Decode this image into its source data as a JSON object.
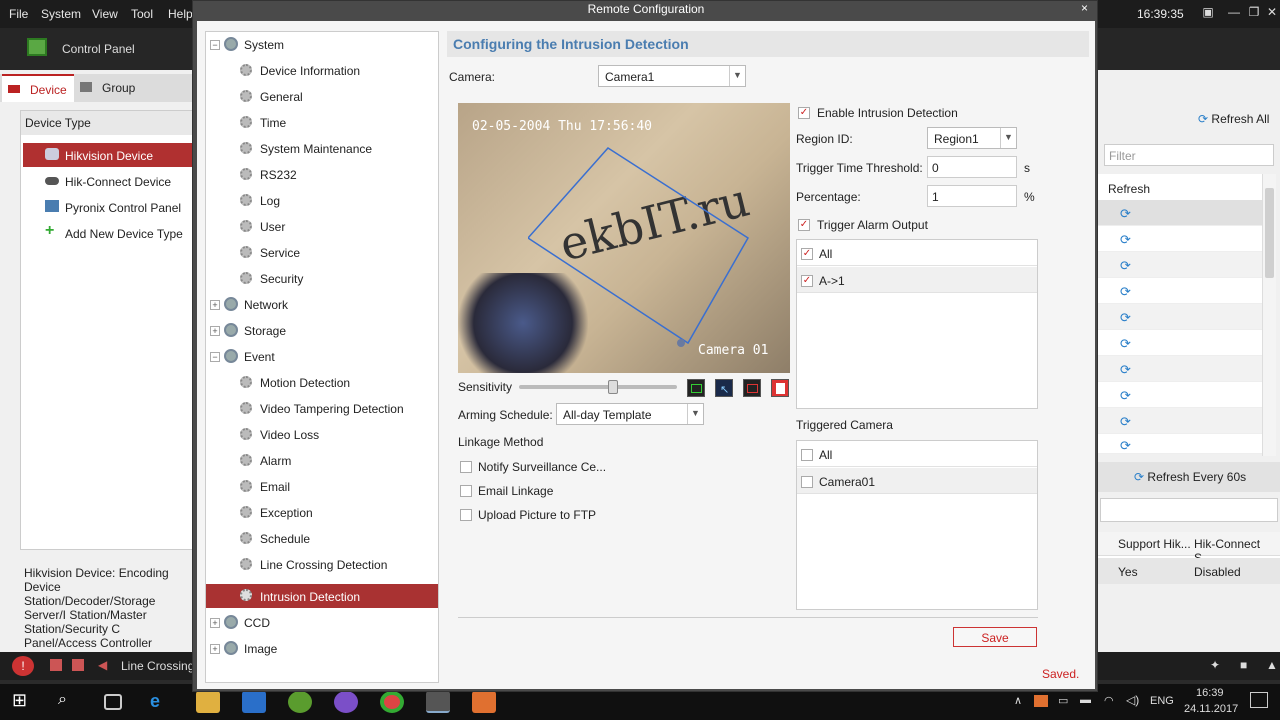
{
  "menubar": {
    "items": [
      "File",
      "System",
      "View",
      "Tool",
      "Help"
    ],
    "clock": "16:39:35"
  },
  "toolbar": {
    "control_panel": "Control Panel"
  },
  "left_panel": {
    "tabs": [
      "Device",
      "Group"
    ],
    "device_type_title": "Device Type",
    "device_types": [
      "Hikvision Device",
      "Hik-Connect Device",
      "Pyronix Control Panel",
      "Add New Device Type"
    ],
    "description": "Hikvision Device: Encoding Device Station/Decoder/Storage Server/I Station/Master Station/Security C Panel/Access Controller"
  },
  "right_panel": {
    "refresh_all": "Refresh All",
    "filter_placeholder": "Filter",
    "refresh_header": "Refresh",
    "refresh_every": "Refresh Every 60s",
    "table_headers": [
      "Support Hik...",
      "Hik-Connect S..."
    ],
    "table_values": [
      "Yes",
      "Disabled"
    ]
  },
  "bottom_strip": {
    "label": "Line Crossing"
  },
  "taskbar": {
    "lang": "ENG",
    "time": "16:39",
    "date": "24.11.2017"
  },
  "dialog": {
    "title": "Remote Configuration",
    "close": "×",
    "tree": {
      "system": "System",
      "system_children": [
        "Device Information",
        "General",
        "Time",
        "System Maintenance",
        "RS232",
        "Log",
        "User",
        "Service",
        "Security"
      ],
      "network": "Network",
      "storage": "Storage",
      "event": "Event",
      "event_children": [
        "Motion Detection",
        "Video Tampering Detection",
        "Video Loss",
        "Alarm",
        "Email",
        "Exception",
        "Schedule",
        "Line Crossing Detection",
        "Intrusion Detection"
      ],
      "ccd": "CCD",
      "image": "Image"
    },
    "content": {
      "title": "Configuring the Intrusion Detection",
      "camera_label": "Camera:",
      "camera_value": "Camera1",
      "video_osd_date": "02-05-2004 Thu 17:56:40",
      "video_osd_camera": "Camera 01",
      "video_watermark": "ekbIT.ru",
      "sensitivity_label": "Sensitivity",
      "sensitivity_level": 0.6,
      "arming_label": "Arming Schedule:",
      "arming_value": "All-day Template",
      "linkage_label": "Linkage Method",
      "linkage_options": [
        "Notify Surveillance Ce...",
        "Email Linkage",
        "Upload Picture to FTP"
      ],
      "enable_label": "Enable Intrusion Detection",
      "region_label": "Region ID:",
      "region_value": "Region1",
      "threshold_label": "Trigger Time Threshold:",
      "threshold_value": "0",
      "threshold_unit": "s",
      "percentage_label": "Percentage:",
      "percentage_value": "1",
      "percentage_unit": "%",
      "trigger_alarm_label": "Trigger Alarm Output",
      "alarm_outputs": [
        "All",
        "A->1"
      ],
      "triggered_camera_label": "Triggered Camera",
      "triggered_cameras": [
        "All",
        "Camera01"
      ],
      "save_label": "Save",
      "status": "Saved."
    }
  }
}
